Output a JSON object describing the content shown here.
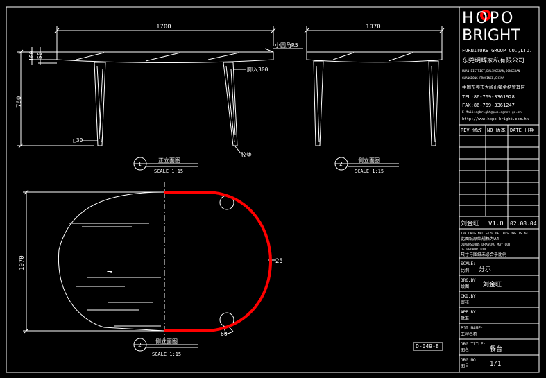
{
  "drawing": {
    "front_view": {
      "length_dim": "1700",
      "top_dim": "100",
      "edge_dim": "50",
      "height_dim": "760",
      "leg_dim": "□30",
      "corner_note": "小圆角R5",
      "inset_note": "脚入300",
      "foot_note": "胶垫",
      "view_no": "1",
      "view_title": "正立面图",
      "scale": "SCALE 1:15"
    },
    "side_view": {
      "width_dim": "1070",
      "view_no": "2",
      "view_title": "侧立面图",
      "scale": "SCALE 1:15"
    },
    "plan_view": {
      "depth_dim": "1070",
      "radius_dim": "25",
      "hole_dim": "60",
      "direction_mark": "⇁",
      "view_no": "2",
      "view_title": "侧立面图",
      "scale": "SCALE 1:15"
    },
    "sheet_code": "D-049-8"
  },
  "title_block": {
    "logo_top": "HOPO",
    "logo_bottom": "BRIGHT",
    "company_en": "FURNITURE GROUP CO.,LTD.",
    "company_cn": "东莞明辉家私有限公司",
    "address_en_1": "HUAN DISTRICT,DALINGSHAN,DONGGUAN",
    "address_en_2": "GUANGDONG PROVINCE,CHINA",
    "address_cn": "中国东莞市大岭山镇金桔管理区",
    "tel": "TEL:86-769-3361928",
    "fax": "FAX:86-769-3361247",
    "email": "E-Mail:dgbright@pub.dgnet.gd.cn",
    "web": "http://www.hopo-bright.com.hk",
    "rev_headers": [
      "REV 修改",
      "NO 版本",
      "DATE 日期"
    ],
    "designer": "刘金旺",
    "version": "V1.0",
    "date": "02.08.04",
    "notes": [
      "THE ORIGINAL SIZE OF THIS DWG IS A4",
      "此图纸原始规格为A4",
      "DIMENSIONS DRAWING MAY OUT",
      "OF PROPORTION",
      "尺寸与图纸未必合乎比例"
    ],
    "scale_label_en": "SCALE:",
    "scale_label_cn": "比例",
    "scale_value": "分示",
    "drawn_label_en": "DRG.BY:",
    "drawn_label_cn": "绘图",
    "drawn_value": "刘金旺",
    "checked_label_en": "CKD.BY:",
    "checked_label_cn": "审核",
    "approved_label_en": "APP.BY:",
    "approved_label_cn": "批准",
    "project_label_en": "PJT.NAME:",
    "project_label_cn": "工程名称",
    "title_label_en": "DRG.TITLE:",
    "title_label_cn": "图名",
    "title_value": "餐台",
    "number_label_en": "DRG.NO:",
    "number_label_cn": "图号",
    "number_value": "1/1"
  },
  "colors": {
    "background": "#000000",
    "line": "#ffffff",
    "highlight": "#ff0000",
    "logo_accent": "#ff0000"
  }
}
